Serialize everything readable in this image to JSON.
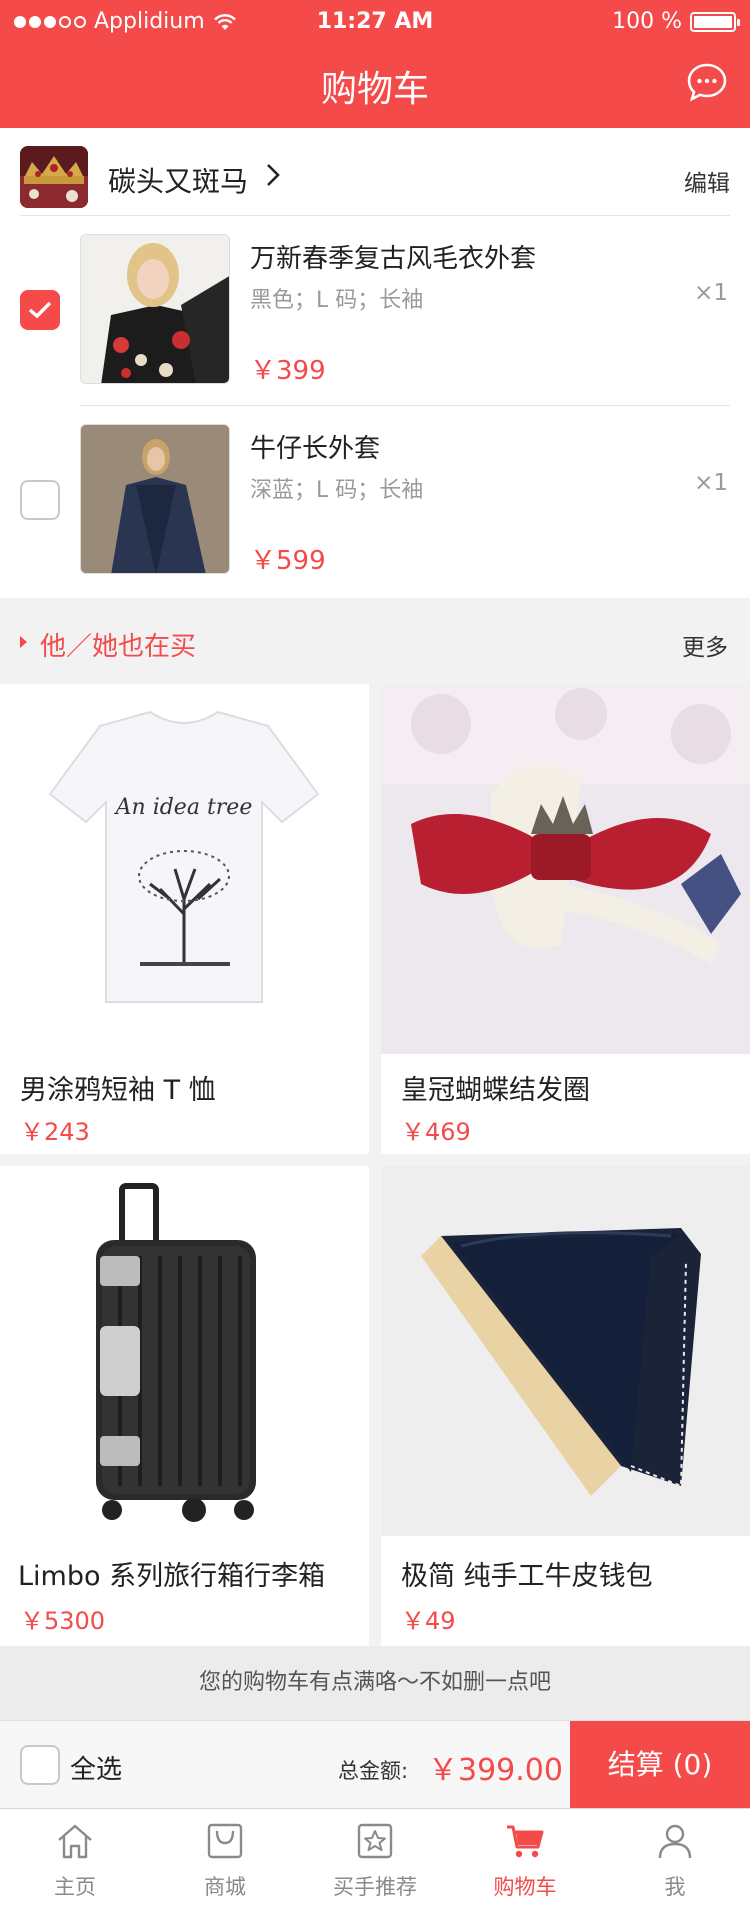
{
  "status_bar": {
    "carrier": "Applidium",
    "time": "11:27 AM",
    "battery": "100 %"
  },
  "header": {
    "title": "购物车",
    "message_icon": "chat-bubble-icon"
  },
  "cart": {
    "shop_name": "碳头又斑马",
    "edit_label": "编辑",
    "items": [
      {
        "name": "万新春季复古风毛衣外套",
        "spec": "黑色；L 码；长袖",
        "qty": "×1",
        "price": "￥399",
        "checked": true
      },
      {
        "name": "牛仔长外套",
        "spec": "深蓝；L 码；长袖",
        "qty": "×1",
        "price": "￥599",
        "checked": false
      }
    ]
  },
  "recommend": {
    "title": "他／她也在买",
    "more": "更多",
    "products": [
      {
        "name": "男涂鸦短袖 T 恤",
        "price": "￥243",
        "shirt_text": "An idea tree"
      },
      {
        "name": "皇冠蝴蝶结发圈",
        "price": "￥469"
      },
      {
        "name": "Limbo 系列旅行箱行李箱",
        "price": "￥5300"
      },
      {
        "name": "极简 纯手工牛皮钱包",
        "price": "￥49"
      }
    ]
  },
  "notice": "您的购物车有点满咯～不如删一点吧",
  "checkout": {
    "select_all": "全选",
    "total_label": "总金额:",
    "total_value": "￥399.00",
    "pay_button": "结算 (0)"
  },
  "tabs": [
    {
      "label": "主页",
      "icon": "home-icon"
    },
    {
      "label": "商城",
      "icon": "shopping-bag-icon"
    },
    {
      "label": "买手推荐",
      "icon": "star-icon"
    },
    {
      "label": "购物车",
      "icon": "cart-icon",
      "active": true
    },
    {
      "label": "我",
      "icon": "user-icon"
    }
  ],
  "colors": {
    "accent": "#f54a4a",
    "background": "#f2f2f2"
  }
}
